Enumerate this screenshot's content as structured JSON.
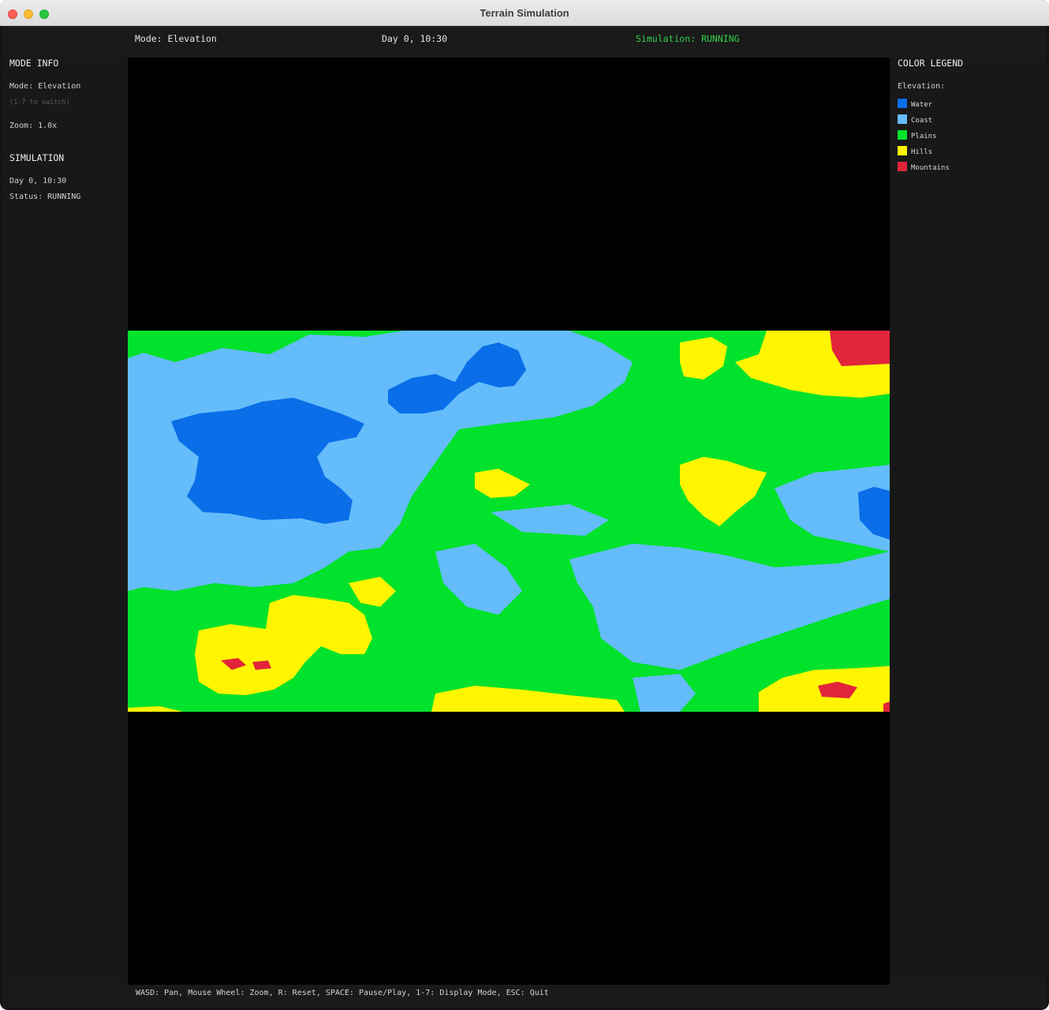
{
  "window": {
    "title": "Terrain Simulation"
  },
  "topbar": {
    "mode": "Mode: Elevation",
    "time": "Day 0, 10:30",
    "status": "Simulation: RUNNING"
  },
  "left_panel": {
    "mode_heading": "MODE INFO",
    "mode_label": "Mode: Elevation",
    "mode_hint": "(1-7 to switch)",
    "zoom": "Zoom: 1.0x",
    "sim_heading": "SIMULATION",
    "sim_time": "Day 0, 10:30",
    "sim_status": "Status: RUNNING"
  },
  "legend": {
    "heading": "COLOR LEGEND",
    "subheading": "Elevation:",
    "items": [
      {
        "label": "Water",
        "color": "#0a6ee8"
      },
      {
        "label": "Coast",
        "color": "#64bcfb"
      },
      {
        "label": "Plains",
        "color": "#00e22b"
      },
      {
        "label": "Hills",
        "color": "#fff500"
      },
      {
        "label": "Mountains",
        "color": "#e2243a"
      }
    ]
  },
  "colors": {
    "water": "#0a6ee8",
    "coast": "#64bcfb",
    "plains": "#00e22b",
    "hills": "#fff500",
    "mountains": "#e2243a",
    "status_green": "#33d14a"
  },
  "footer": {
    "controls": "WASD: Pan, Mouse Wheel: Zoom, R: Reset, SPACE: Pause/Play, 1-7: Display Mode, ESC: Quit"
  }
}
